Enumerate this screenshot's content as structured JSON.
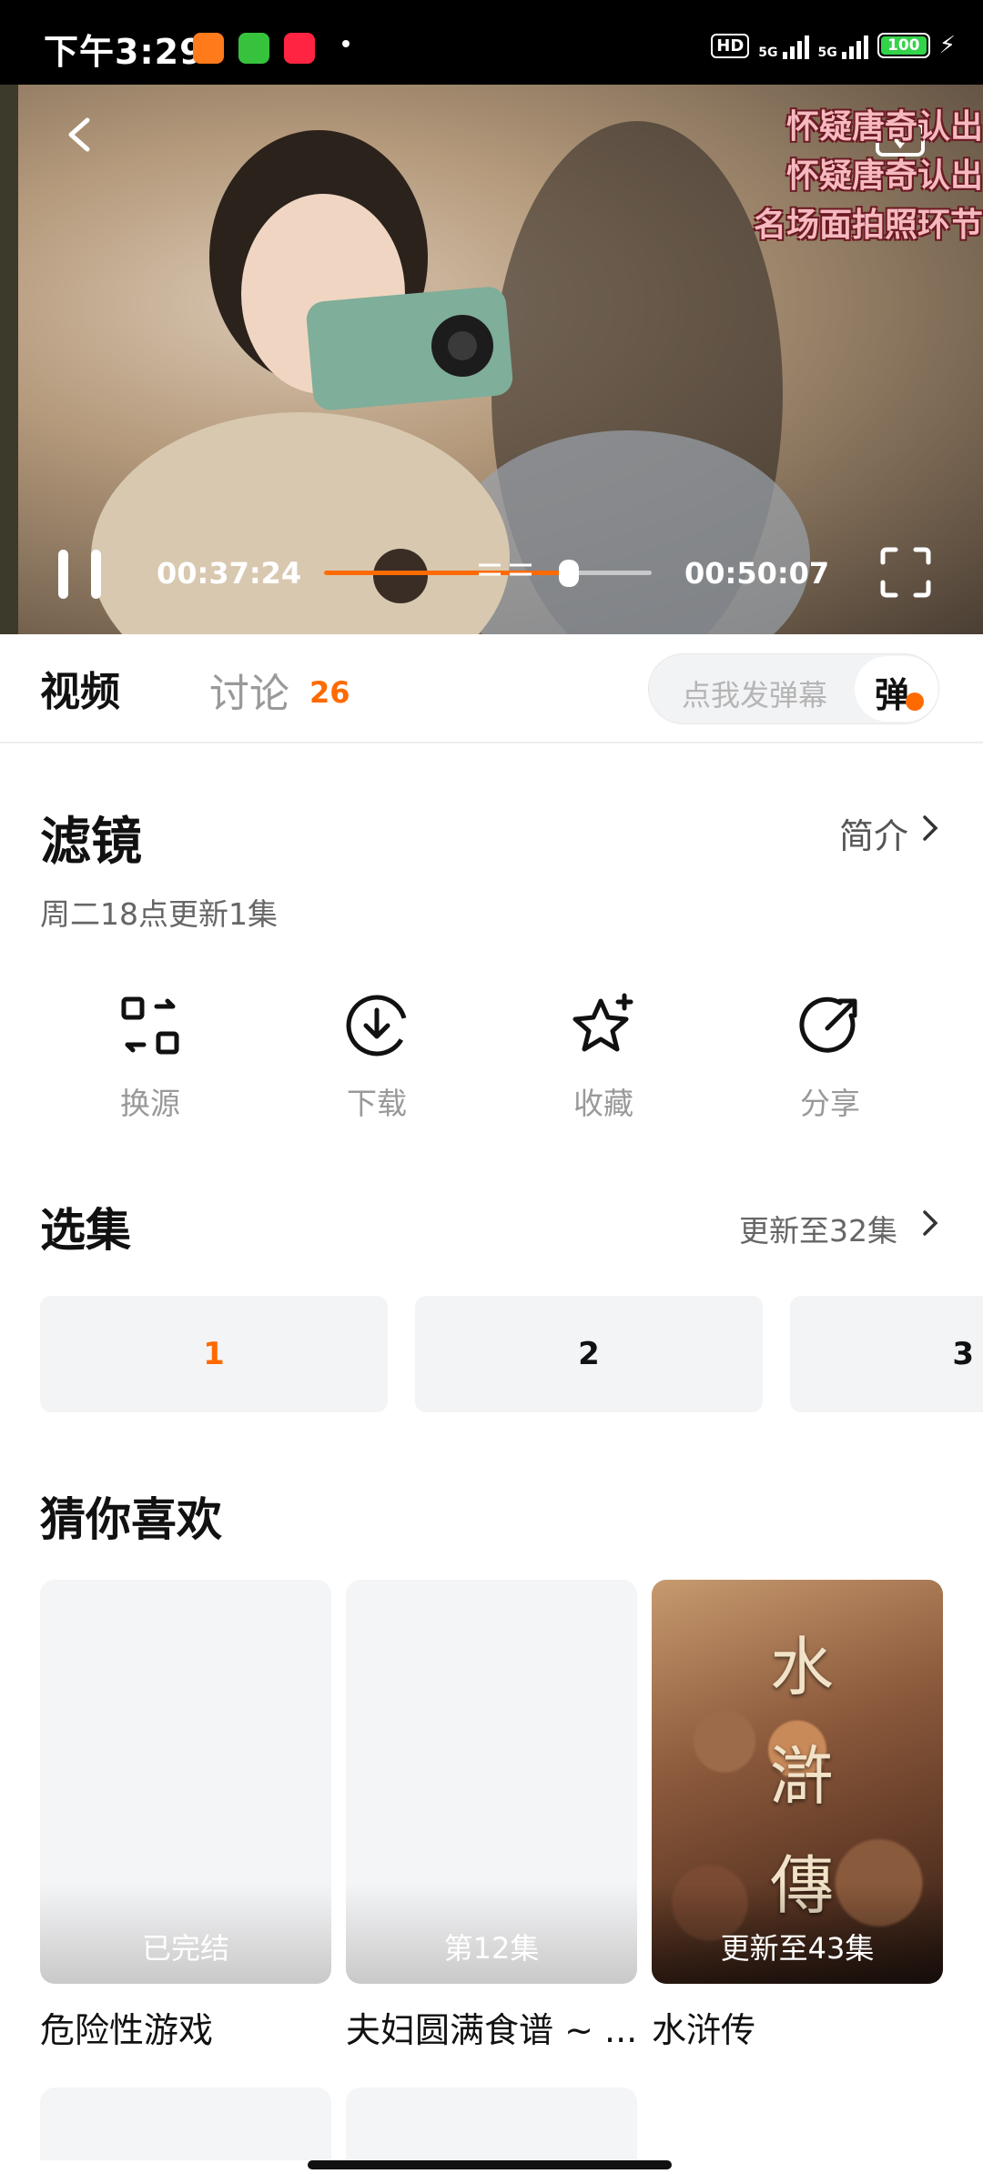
{
  "status_bar": {
    "time": "下午3:29",
    "hd_label": "HD",
    "sig1_label": "5G",
    "sig2_label": "5G",
    "battery": "100",
    "battery_level": 1.0,
    "app_colors": [
      "#ff7a1a",
      "#37c23d",
      "#ff2442"
    ]
  },
  "player": {
    "danmaku": [
      "怀疑唐奇认出",
      "怀疑唐奇认出",
      "名场面拍照环节"
    ],
    "current_time": "00:37:24",
    "total_time": "00:50:07",
    "progress": 0.746,
    "accent": "#ff6a00"
  },
  "tabs": {
    "video": "视频",
    "discussion": "讨论",
    "discussion_count": "26",
    "danmu_placeholder": "点我发弹幕",
    "danmu_button": "弹"
  },
  "show": {
    "title": "滤镜",
    "intro_label": "简介",
    "update_info": "周二18点更新1集"
  },
  "actions": [
    {
      "label": "换源",
      "icon": "switch-source-icon"
    },
    {
      "label": "下载",
      "icon": "download-icon"
    },
    {
      "label": "收藏",
      "icon": "favorite-star-icon"
    },
    {
      "label": "分享",
      "icon": "share-icon"
    }
  ],
  "episodes": {
    "section_title": "选集",
    "update_status": "更新至32集",
    "items": [
      "1",
      "2",
      "3"
    ],
    "selected": "1"
  },
  "recommend": {
    "section_title": "猜你喜欢",
    "items": [
      {
        "title": "危险性游戏",
        "badge": "已完结"
      },
      {
        "title": "夫妇圆满食谱 ~ ...",
        "badge": "第12集"
      },
      {
        "title": "水浒传",
        "badge": "更新至43集",
        "poster_text": [
          "水",
          "滸",
          "傳"
        ]
      }
    ]
  }
}
